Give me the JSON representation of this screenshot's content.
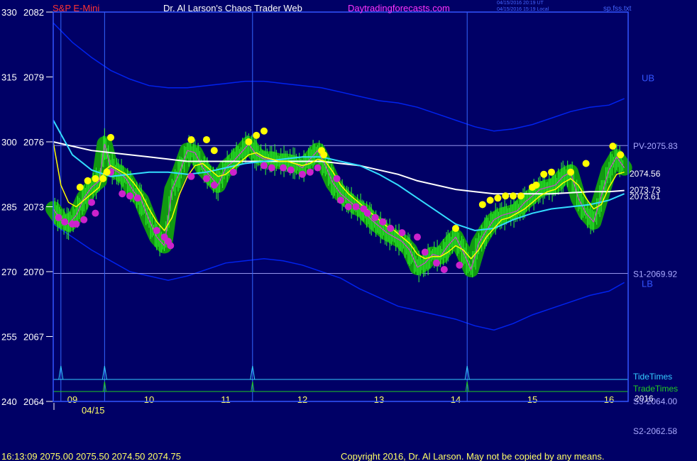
{
  "header": {
    "symbol": "S&P E-Mini",
    "site": "Dr. Al Larson's Chaos Trader Web",
    "url": "Daytradingforecasts.com",
    "stamp1": "04/15/2016 20:19 UT",
    "stamp2": "04/15/2016 15:19 Local",
    "file": "sp.fss.txt"
  },
  "footer": {
    "quote": "16:13:09  2075.00 2075.50 2074.50 2074.75",
    "copyright": "Copyright 2016, Dr. Al Larson. May not be copied by any means."
  },
  "chart_data": {
    "type": "line",
    "date_label": "04/15",
    "y_axis": {
      "left_index_ticks": [
        "330",
        "315",
        "300",
        "285",
        "270",
        "255",
        "240"
      ],
      "price_ticks": [
        2082,
        2079,
        2076,
        2073,
        2070,
        2067,
        2064
      ],
      "ylim": [
        2064,
        2082
      ]
    },
    "x_axis": {
      "range": [
        8.75,
        16.25
      ],
      "hour_labels": [
        "09",
        "10",
        "11",
        "12",
        "13",
        "14",
        "15",
        "16"
      ]
    },
    "levels": [
      {
        "label": "PV-2075.83",
        "value": 2075.83
      },
      {
        "label": "S1-2069.92",
        "value": 2069.92
      }
    ],
    "off_scale_labels": [
      "S3-2064.00",
      "S2-2062.58"
    ],
    "band_labels": [
      "UB",
      "LB"
    ],
    "last_values": [
      "2074.56",
      "2073.73",
      "2073.61"
    ],
    "tide_times": {
      "label": "TideTimes",
      "x": [
        8.85,
        9.42,
        11.35,
        14.15
      ]
    },
    "trade_times": {
      "label": "TradeTimes",
      "x": [
        9.42,
        11.35,
        14.15
      ]
    },
    "trade_year": "2016",
    "vertical_markers_x": [
      8.85,
      9.42,
      11.35,
      14.15
    ],
    "series": [
      {
        "name": "price",
        "color": "#00ff00",
        "x": [
          8.75,
          8.85,
          8.95,
          9.05,
          9.15,
          9.25,
          9.35,
          9.42,
          9.5,
          9.6,
          9.7,
          9.8,
          9.9,
          10.0,
          10.1,
          10.2,
          10.3,
          10.4,
          10.5,
          10.6,
          10.7,
          10.8,
          10.9,
          11.0,
          11.1,
          11.2,
          11.3,
          11.4,
          11.5,
          11.6,
          11.7,
          11.8,
          11.9,
          12.0,
          12.1,
          12.2,
          12.3,
          12.4,
          12.5,
          12.6,
          12.7,
          12.8,
          12.9,
          13.0,
          13.1,
          13.2,
          13.3,
          13.4,
          13.5,
          13.6,
          13.7,
          13.8,
          13.9,
          14.0,
          14.1,
          14.2,
          14.3,
          14.4,
          14.5,
          14.6,
          14.7,
          14.8,
          14.9,
          15.0,
          15.1,
          15.2,
          15.3,
          15.4,
          15.5,
          15.6,
          15.7,
          15.8,
          15.9,
          16.0,
          16.1,
          16.2
        ],
        "y": [
          2072.9,
          2072.4,
          2072.2,
          2072.6,
          2073.4,
          2073.9,
          2074.2,
          2075.9,
          2074.8,
          2074.6,
          2074.3,
          2073.7,
          2073.3,
          2072.4,
          2071.6,
          2071.2,
          2073.8,
          2074.6,
          2075.6,
          2075.5,
          2074.8,
          2074.4,
          2074.0,
          2074.8,
          2075.1,
          2075.5,
          2075.9,
          2075.4,
          2075.2,
          2075.2,
          2075.1,
          2075.1,
          2075.0,
          2074.8,
          2075.2,
          2075.6,
          2074.9,
          2074.1,
          2073.6,
          2073.3,
          2073.0,
          2072.8,
          2072.4,
          2072.1,
          2071.8,
          2071.6,
          2071.4,
          2071.0,
          2070.2,
          2070.4,
          2070.8,
          2070.7,
          2071.2,
          2071.6,
          2070.9,
          2070.1,
          2071.3,
          2071.9,
          2072.4,
          2072.6,
          2072.7,
          2072.8,
          2073.2,
          2073.5,
          2073.8,
          2073.9,
          2074.0,
          2074.4,
          2074.6,
          2073.4,
          2072.7,
          2072.3,
          2073.5,
          2074.7,
          2075.3,
          2074.8
        ]
      },
      {
        "name": "fast-average",
        "color": "#ffff00",
        "x": [
          8.75,
          8.85,
          8.95,
          9.05,
          9.15,
          9.25,
          9.35,
          9.42,
          9.5,
          9.6,
          9.7,
          9.8,
          9.9,
          10.0,
          10.1,
          10.2,
          10.3,
          10.4,
          10.5,
          10.6,
          10.7,
          10.8,
          10.9,
          11.0,
          11.1,
          11.2,
          11.3,
          11.4,
          11.5,
          11.6,
          11.7,
          11.8,
          11.9,
          12.0,
          12.1,
          12.2,
          12.3,
          12.4,
          12.5,
          12.6,
          12.7,
          12.8,
          12.9,
          13.0,
          13.1,
          13.2,
          13.3,
          13.4,
          13.5,
          13.6,
          13.7,
          13.8,
          13.9,
          14.0,
          14.1,
          14.2,
          14.3,
          14.4,
          14.5,
          14.6,
          14.7,
          14.8,
          14.9,
          15.0,
          15.1,
          15.2,
          15.3,
          15.4,
          15.5,
          15.6,
          15.7,
          15.8,
          15.9,
          16.0,
          16.1,
          16.2
        ],
        "y": [
          2076.0,
          2074.0,
          2073.2,
          2073.0,
          2073.3,
          2073.6,
          2073.9,
          2074.7,
          2074.9,
          2074.7,
          2074.5,
          2074.1,
          2073.6,
          2072.9,
          2072.3,
          2071.9,
          2072.5,
          2073.6,
          2074.4,
          2074.9,
          2075.0,
          2074.7,
          2074.4,
          2074.5,
          2074.8,
          2075.1,
          2075.4,
          2075.5,
          2075.3,
          2075.2,
          2075.1,
          2075.1,
          2075.0,
          2074.9,
          2075.0,
          2075.2,
          2075.1,
          2074.6,
          2074.0,
          2073.6,
          2073.3,
          2073.0,
          2072.7,
          2072.4,
          2072.1,
          2071.9,
          2071.6,
          2071.3,
          2070.8,
          2070.6,
          2070.7,
          2070.7,
          2070.9,
          2071.2,
          2071.0,
          2070.6,
          2071.0,
          2071.6,
          2072.0,
          2072.4,
          2072.5,
          2072.7,
          2072.9,
          2073.2,
          2073.5,
          2073.7,
          2073.8,
          2074.1,
          2074.3,
          2074.0,
          2073.4,
          2072.9,
          2073.1,
          2073.9,
          2074.5,
          2074.6
        ]
      },
      {
        "name": "cyan-average",
        "color": "#33ddff",
        "x": [
          8.75,
          9.0,
          9.25,
          9.5,
          9.75,
          10.0,
          10.25,
          10.5,
          10.75,
          11.0,
          11.25,
          11.5,
          11.75,
          12.0,
          12.25,
          12.5,
          12.75,
          13.0,
          13.25,
          13.5,
          13.75,
          14.0,
          14.25,
          14.5,
          14.75,
          15.0,
          15.25,
          15.5,
          15.75,
          16.0,
          16.2
        ],
        "y": [
          2077.0,
          2075.4,
          2074.7,
          2074.4,
          2074.5,
          2074.6,
          2074.6,
          2074.5,
          2074.6,
          2074.8,
          2075.0,
          2075.1,
          2075.2,
          2075.3,
          2075.3,
          2075.1,
          2074.9,
          2074.5,
          2074.0,
          2073.4,
          2072.8,
          2072.2,
          2071.9,
          2072.0,
          2072.4,
          2072.7,
          2072.9,
          2073.0,
          2073.1,
          2073.3,
          2073.6
        ]
      },
      {
        "name": "white-average",
        "color": "#ffffff",
        "x": [
          8.75,
          9.0,
          9.25,
          9.5,
          9.75,
          10.0,
          10.25,
          10.5,
          10.75,
          11.0,
          11.25,
          11.5,
          11.75,
          12.0,
          12.25,
          12.5,
          12.75,
          13.0,
          13.25,
          13.5,
          13.75,
          14.0,
          14.25,
          14.5,
          14.75,
          15.0,
          15.25,
          15.5,
          15.75,
          16.0,
          16.2
        ],
        "y": [
          2076.0,
          2075.8,
          2075.6,
          2075.5,
          2075.4,
          2075.3,
          2075.2,
          2075.1,
          2075.1,
          2075.1,
          2075.1,
          2075.1,
          2075.1,
          2075.1,
          2075.1,
          2075.0,
          2074.9,
          2074.7,
          2074.5,
          2074.2,
          2074.0,
          2073.8,
          2073.7,
          2073.6,
          2073.6,
          2073.6,
          2073.6,
          2073.65,
          2073.7,
          2073.7,
          2073.75
        ]
      },
      {
        "name": "upper-band",
        "color": "#0022ee",
        "x": [
          8.75,
          9.0,
          9.25,
          9.5,
          9.75,
          10.0,
          10.25,
          10.5,
          10.75,
          11.0,
          11.25,
          11.5,
          11.75,
          12.0,
          12.25,
          12.5,
          12.75,
          13.0,
          13.25,
          13.5,
          13.75,
          14.0,
          14.25,
          14.5,
          14.75,
          15.0,
          15.25,
          15.5,
          15.75,
          16.0,
          16.2
        ],
        "y": [
          2081.5,
          2080.6,
          2079.9,
          2079.3,
          2078.9,
          2078.6,
          2078.5,
          2078.5,
          2078.6,
          2078.7,
          2078.8,
          2078.8,
          2078.7,
          2078.6,
          2078.5,
          2078.3,
          2078.1,
          2077.9,
          2077.8,
          2077.6,
          2077.3,
          2077.0,
          2076.7,
          2076.5,
          2076.6,
          2076.8,
          2077.1,
          2077.4,
          2077.6,
          2077.7,
          2078.0
        ]
      },
      {
        "name": "lower-band",
        "color": "#0022ee",
        "x": [
          8.75,
          9.0,
          9.25,
          9.5,
          9.75,
          10.0,
          10.25,
          10.5,
          10.75,
          11.0,
          11.25,
          11.5,
          11.75,
          12.0,
          12.25,
          12.5,
          12.75,
          13.0,
          13.25,
          13.5,
          13.75,
          14.0,
          14.25,
          14.5,
          14.75,
          15.0,
          15.25,
          15.5,
          15.75,
          16.0,
          16.2
        ],
        "y": [
          2072.2,
          2071.6,
          2071.0,
          2070.5,
          2070.0,
          2069.8,
          2069.6,
          2069.8,
          2070.1,
          2070.4,
          2070.5,
          2070.6,
          2070.5,
          2070.3,
          2070.0,
          2069.7,
          2069.2,
          2068.8,
          2068.4,
          2068.2,
          2068.0,
          2067.8,
          2067.5,
          2067.3,
          2067.6,
          2068.0,
          2068.3,
          2068.6,
          2068.9,
          2069.1,
          2069.5
        ]
      }
    ],
    "dots_yellow": {
      "color": "#ffff00",
      "x": [
        9.1,
        9.2,
        9.3,
        9.4,
        9.45,
        9.5,
        10.55,
        10.75,
        10.85,
        11.3,
        11.4,
        11.5,
        12.25,
        12.28,
        14.0,
        14.35,
        14.45,
        14.55,
        14.65,
        14.75,
        14.85,
        15.0,
        15.05,
        15.15,
        15.25,
        15.5,
        15.7,
        16.05,
        16.15
      ],
      "y": [
        2073.9,
        2074.2,
        2074.3,
        2074.3,
        2074.6,
        2076.2,
        2076.1,
        2076.1,
        2075.6,
        2076.0,
        2076.3,
        2076.5,
        2075.6,
        2075.4,
        2072.0,
        2073.1,
        2073.3,
        2073.4,
        2073.5,
        2073.5,
        2073.5,
        2073.9,
        2074.0,
        2074.5,
        2074.6,
        2074.6,
        2075.0,
        2075.8,
        2075.4
      ]
    },
    "dots_magenta": {
      "color": "#cc22cc",
      "x": [
        8.82,
        8.9,
        9.0,
        9.05,
        9.15,
        9.25,
        9.3,
        9.5,
        9.65,
        9.75,
        9.85,
        10.1,
        10.2,
        10.25,
        10.28,
        10.55,
        10.75,
        10.85,
        11.1,
        11.5,
        11.6,
        11.75,
        11.85,
        12.0,
        12.1,
        12.2,
        12.45,
        12.5,
        12.6,
        12.7,
        12.8,
        12.85,
        12.95,
        13.05,
        13.15,
        13.3,
        13.5,
        13.6,
        13.75,
        13.85,
        14.05
      ],
      "y": [
        2072.5,
        2072.3,
        2072.2,
        2072.2,
        2072.4,
        2073.2,
        2072.7,
        2074.6,
        2073.6,
        2073.5,
        2073.4,
        2071.9,
        2071.6,
        2071.4,
        2071.2,
        2074.4,
        2074.3,
        2074.0,
        2074.6,
        2074.9,
        2074.8,
        2074.8,
        2074.7,
        2074.5,
        2074.6,
        2074.8,
        2074.3,
        2073.3,
        2073.0,
        2073.0,
        2072.9,
        2072.7,
        2072.5,
        2072.3,
        2072.0,
        2071.8,
        2071.6,
        2070.9,
        2070.4,
        2070.1,
        2070.3
      ]
    }
  }
}
